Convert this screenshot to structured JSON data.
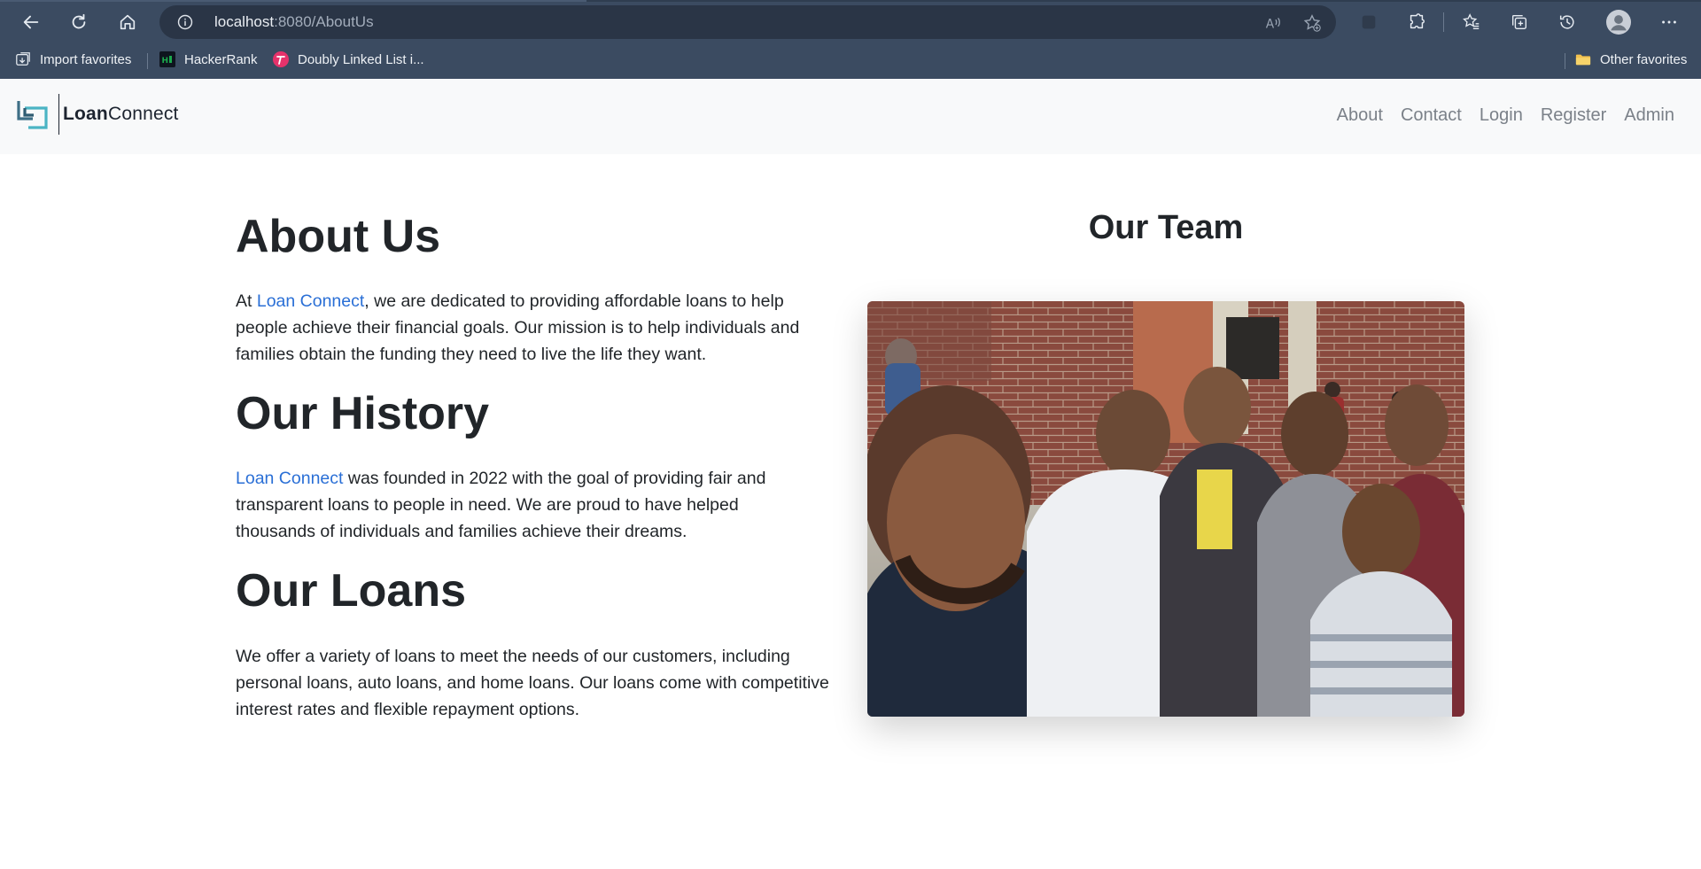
{
  "browser": {
    "url_host": "localhost",
    "url_rest": ":8080/AboutUs",
    "bookmarks": [
      {
        "label": "Import favorites",
        "icon": "import-icon"
      },
      {
        "label": "HackerRank",
        "icon": "hackerrank-icon"
      },
      {
        "label": "Doubly Linked List i...",
        "icon": "tab-favicon-icon"
      }
    ],
    "other_favorites": "Other favorites"
  },
  "navbar": {
    "brand_bold": "Loan",
    "brand_rest": "Connect",
    "links": [
      "About",
      "Contact",
      "Login",
      "Register",
      "Admin"
    ]
  },
  "about": {
    "title": "About Us",
    "text_before": "At ",
    "link": "Loan Connect",
    "text_after": ", we are dedicated to providing affordable loans to help people achieve their financial goals. Our mission is to help individuals and families obtain the funding they need to live the life they want."
  },
  "history": {
    "title": "Our History",
    "link": "Loan Connect",
    "text_after": " was founded in 2022 with the goal of providing fair and transparent loans to people in need. We are proud to have helped thousands of individuals and families achieve their dreams."
  },
  "loans": {
    "title": "Our Loans",
    "text": "We offer a variety of loans to meet the needs of our customers, including personal loans, auto loans, and home loans. Our loans come with competitive interest rates and flexible repayment options."
  },
  "team": {
    "title": "Our Team"
  },
  "colors": {
    "chrome": "#3b4b61",
    "address_bar": "#2a3546",
    "navbar_bg": "#f8f9fa",
    "link": "#2a6fd6",
    "nav_link": "#7b8189",
    "brand_teal": "#4bb4c4"
  }
}
